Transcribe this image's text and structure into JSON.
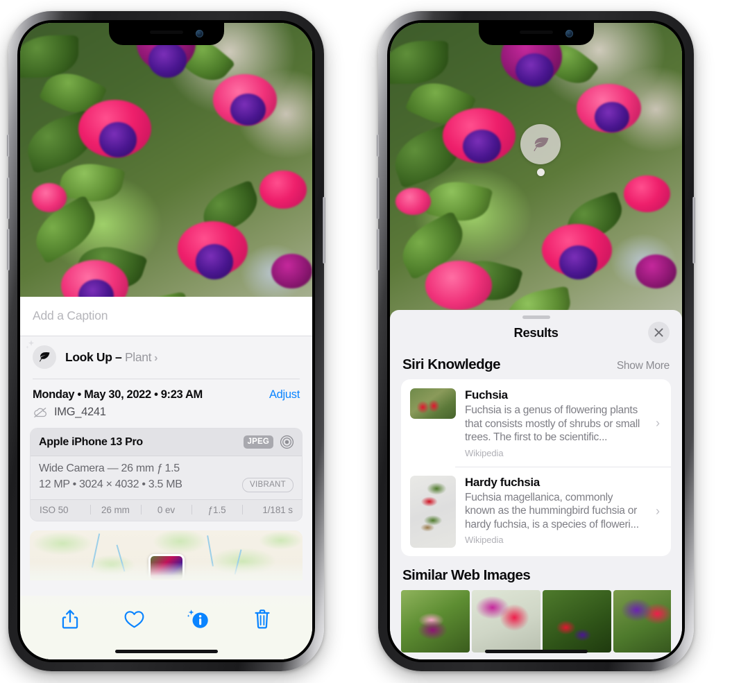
{
  "left_phone": {
    "photo": {
      "alt_name": "fuchsia-flowers-photo"
    },
    "caption": {
      "placeholder": "Add a Caption",
      "value": ""
    },
    "look_up": {
      "icon": "leaf-icon",
      "sparkle_icon": "sparkles-icon",
      "label": "Look Up – ",
      "subject": "Plant",
      "chevron": "›"
    },
    "date_row": {
      "date_text": "Monday • May 30, 2022 • 9:23 AM",
      "adjust_label": "Adjust"
    },
    "file_row": {
      "icon": "icloud-slash-icon",
      "filename": "IMG_4241"
    },
    "camera_card": {
      "device": "Apple iPhone 13 Pro",
      "format_badge": "JPEG",
      "lens_icon": "camera-lens-icon",
      "lens_line": "Wide Camera — 26 mm ƒ 1.5",
      "specs_line": "12 MP • 3024 × 4032 • 3.5 MB",
      "quality_badge": "VIBRANT",
      "exif": [
        "ISO 50",
        "26 mm",
        "0 ev",
        "ƒ1.5",
        "1/181 s"
      ]
    },
    "map": {
      "name": "photo-location-map",
      "pin": "photo-pin-thumbnail"
    },
    "toolbar": [
      {
        "name": "share-button",
        "icon": "share-icon"
      },
      {
        "name": "favorite-button",
        "icon": "heart-icon"
      },
      {
        "name": "info-button",
        "icon": "info-sparkle-icon",
        "active": true
      },
      {
        "name": "delete-button",
        "icon": "trash-icon"
      }
    ]
  },
  "right_phone": {
    "photo": {
      "alt_name": "fuchsia-flowers-photo"
    },
    "visual_lookup_badge": {
      "icon": "leaf-icon",
      "name": "visual-look-up-badge"
    },
    "sheet": {
      "grabber": "sheet-grabber",
      "title": "Results",
      "close_icon": "close-icon"
    },
    "siri_knowledge": {
      "heading": "Siri Knowledge",
      "show_more": "Show More",
      "cards": [
        {
          "title": "Fuchsia",
          "description": "Fuchsia is a genus of flowering plants that consists mostly of shrubs or small trees. The first to be scientific...",
          "source": "Wikipedia",
          "thumb": "fuchsia-thumbnail",
          "chevron": "›"
        },
        {
          "title": "Hardy fuchsia",
          "description": "Fuchsia magellanica, commonly known as the hummingbird fuchsia or hardy fuchsia, is a species of floweri...",
          "source": "Wikipedia",
          "thumb": "hardy-fuchsia-thumbnail",
          "chevron": "›"
        }
      ]
    },
    "similar_web_images": {
      "heading": "Similar Web Images",
      "images": [
        {
          "name": "similar-image-1"
        },
        {
          "name": "similar-image-2"
        },
        {
          "name": "similar-image-3"
        },
        {
          "name": "similar-image-4"
        }
      ]
    }
  },
  "colors": {
    "accent_blue": "#0a84ff",
    "sheet_bg": "#f1f1f4",
    "card_bg": "#ffffff",
    "secondary_text": "#8a8a90"
  }
}
